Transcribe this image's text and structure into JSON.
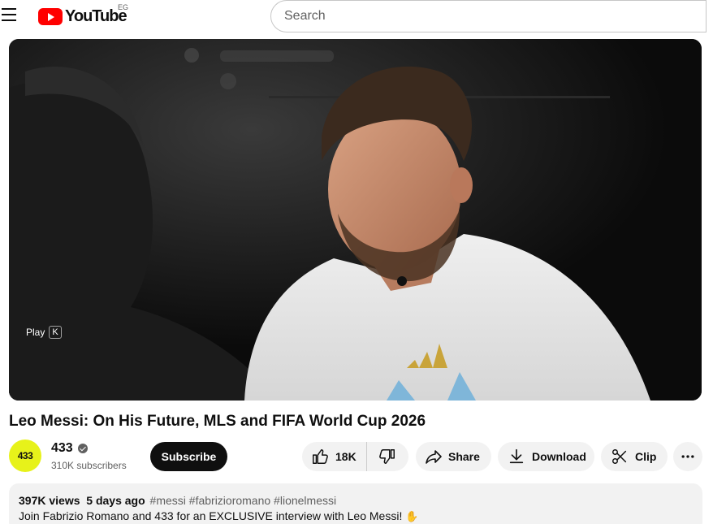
{
  "header": {
    "logo_text": "YouTube",
    "region": "EG",
    "search_placeholder": "Search"
  },
  "player": {
    "play_hint": "Play",
    "play_key": "K"
  },
  "video": {
    "title": "Leo Messi: On His Future, MLS and FIFA World Cup 2026"
  },
  "channel": {
    "avatar_text": "433",
    "name": "433",
    "subscribers": "310K subscribers",
    "subscribe_label": "Subscribe"
  },
  "actions": {
    "likes": "18K",
    "share_label": "Share",
    "download_label": "Download",
    "clip_label": "Clip"
  },
  "description": {
    "views": "397K views",
    "date": "5 days ago",
    "tags": "#messi #fabrizioromano #lionelmessi",
    "text": "Join Fabrizio Romano and 433 for an EXCLUSIVE interview with Leo Messi!",
    "emoji": "✋"
  },
  "colors": {
    "brand_red": "#ff0000",
    "avatar_yellow": "#e7f21a",
    "pill_bg": "#f2f2f2"
  }
}
